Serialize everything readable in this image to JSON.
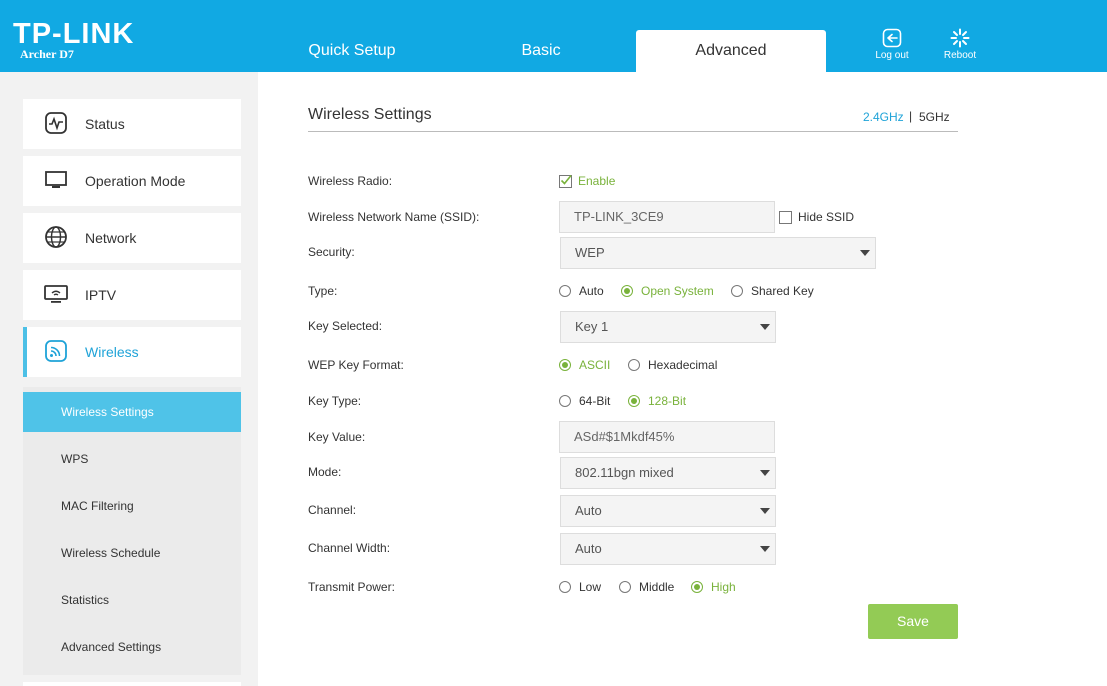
{
  "header": {
    "logo": "TP-LINK",
    "model": "Archer D7",
    "tabs": [
      {
        "label": "Quick Setup"
      },
      {
        "label": "Basic"
      },
      {
        "label": "Advanced"
      }
    ],
    "logout_label": "Log out",
    "reboot_label": "Reboot",
    "color": "#11a9e3"
  },
  "sidebar": {
    "items": [
      {
        "label": "Status",
        "icon": "status-pulse-icon"
      },
      {
        "label": "Operation Mode",
        "icon": "monitor-icon"
      },
      {
        "label": "Network",
        "icon": "globe-icon"
      },
      {
        "label": "IPTV",
        "icon": "iptv-icon"
      },
      {
        "label": "Wireless",
        "icon": "wireless-icon"
      }
    ],
    "submenu": [
      {
        "label": "Wireless Settings"
      },
      {
        "label": "WPS"
      },
      {
        "label": "MAC Filtering"
      },
      {
        "label": "Wireless Schedule"
      },
      {
        "label": "Statistics"
      },
      {
        "label": "Advanced Settings"
      }
    ],
    "active_color": "#4fc3e8"
  },
  "main": {
    "title": "Wireless Settings",
    "bands": [
      "2.4GHz",
      "5GHz"
    ],
    "band_separator": "|",
    "labels": {
      "radio": "Wireless Radio:",
      "ssid": "Wireless Network Name (SSID):",
      "security": "Security:",
      "type": "Type:",
      "key_selected": "Key Selected:",
      "wep_key_format": "WEP Key Format:",
      "key_type": "Key Type:",
      "key_value": "Key Value:",
      "mode": "Mode:",
      "channel": "Channel:",
      "channel_width": "Channel Width:",
      "transmit_power": "Transmit Power:"
    },
    "radio_enable": "Enable",
    "ssid_value": "TP-LINK_3CE9",
    "hide_ssid": "Hide SSID",
    "security_value": "WEP",
    "type_options": [
      "Auto",
      "Open System",
      "Shared Key"
    ],
    "key_selected_value": "Key 1",
    "key_format_options": [
      "ASCII",
      "Hexadecimal"
    ],
    "key_type_options": [
      "64-Bit",
      "128-Bit"
    ],
    "key_value": "ASd#$1Mkdf45%",
    "mode_value": "802.11bgn mixed",
    "channel_value": "Auto",
    "channel_width_value": "Auto",
    "power_options": [
      "Low",
      "Middle",
      "High"
    ],
    "save_label": "Save",
    "accent_color": "#79b23b",
    "save_color": "#93cb55"
  }
}
